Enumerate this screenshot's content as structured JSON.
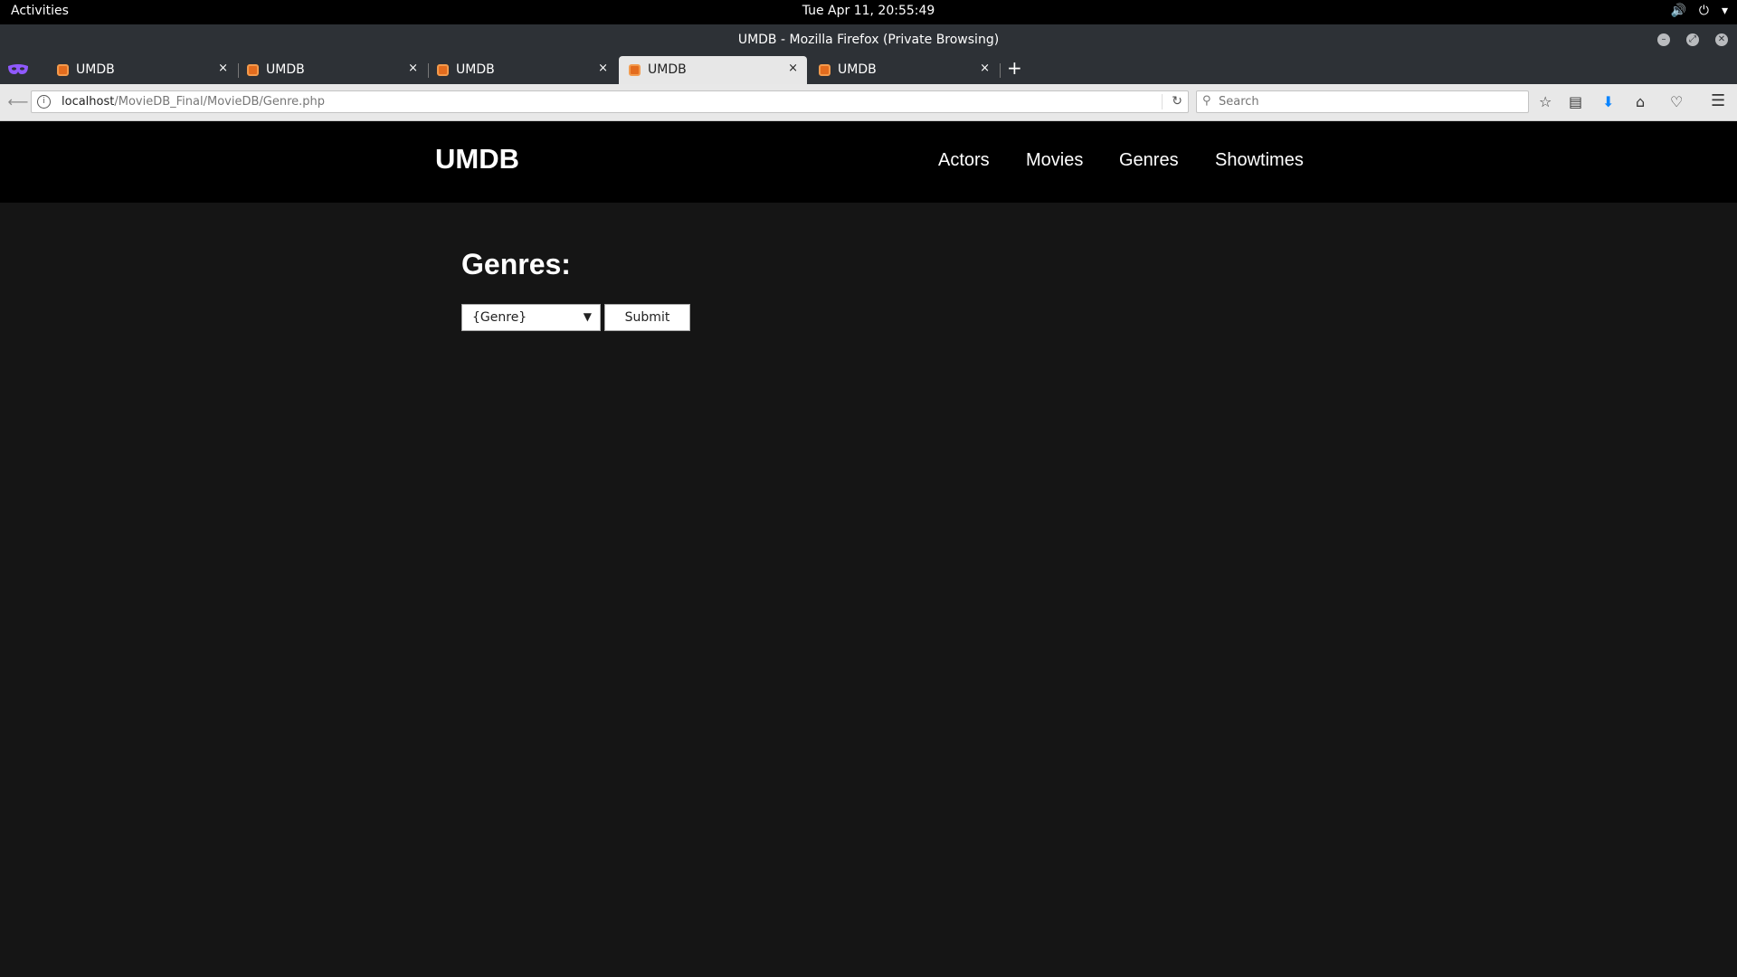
{
  "system": {
    "activities": "Activities",
    "clock": "Tue Apr 11, 20:55:49"
  },
  "window": {
    "title": "UMDB - Mozilla Firefox (Private Browsing)"
  },
  "tabs": [
    {
      "label": "UMDB",
      "active": false
    },
    {
      "label": "UMDB",
      "active": false
    },
    {
      "label": "UMDB",
      "active": false
    },
    {
      "label": "UMDB",
      "active": true
    },
    {
      "label": "UMDB",
      "active": false
    }
  ],
  "tab_close_glyph": "×",
  "toolbar": {
    "url_host": "localhost",
    "url_path": "/MovieDB_Final/MovieDB/Genre.php",
    "search_placeholder": "Search"
  },
  "site": {
    "brand": "UMDB",
    "nav": [
      "Actors",
      "Movies",
      "Genres",
      "Showtimes"
    ]
  },
  "page": {
    "heading": "Genres:",
    "select_value": "{Genre}",
    "submit_label": "Submit"
  },
  "colors": {
    "header_bg": "#000000",
    "page_bg": "#151515",
    "favicon": "#e36c1e",
    "download_arrow": "#0a84ff"
  },
  "icons": [
    "private-browsing-mask-icon",
    "xampp-favicon-icon",
    "bookmark-star-icon",
    "reader-list-icon",
    "download-icon",
    "home-icon",
    "pocket-icon",
    "hamburger-menu-icon"
  ]
}
